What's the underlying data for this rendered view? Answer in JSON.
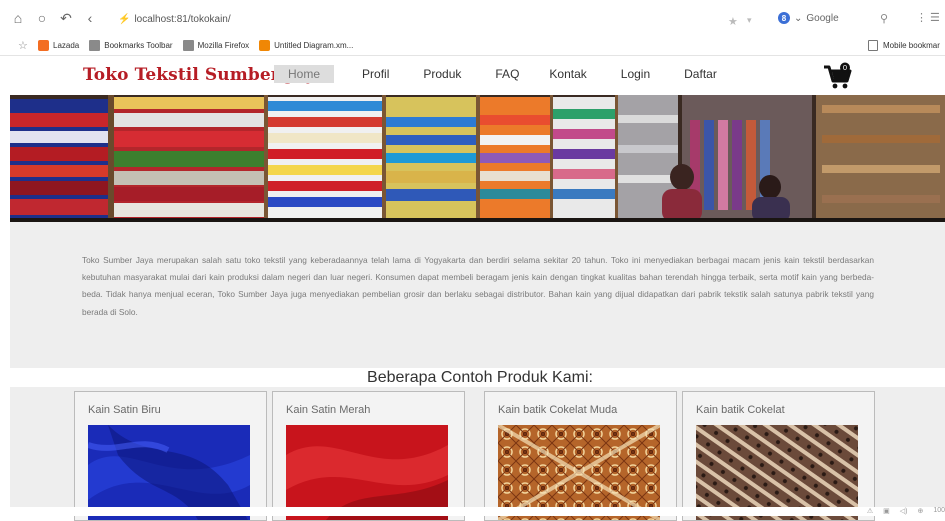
{
  "browser": {
    "url": "localhost:81/tokokain/",
    "search_engine": "Google",
    "bookmarks": [
      {
        "label": "Lazada",
        "icon": "lazada-icon"
      },
      {
        "label": "Bookmarks Toolbar",
        "icon": "folder-icon"
      },
      {
        "label": "Mozilla Firefox",
        "icon": "folder-icon"
      },
      {
        "label": "Untitled Diagram.xm...",
        "icon": "drawio-icon"
      }
    ],
    "mobile_bookmarks": "Mobile bookmar",
    "zoom": "100"
  },
  "site": {
    "brand": "Toko Tekstil Sumber Jaya",
    "menu": [
      {
        "label": "Home",
        "active": true
      },
      {
        "label": "Profil",
        "active": false
      },
      {
        "label": "Produk",
        "active": false
      },
      {
        "label": "FAQ",
        "active": false
      },
      {
        "label": "Kontak",
        "active": false
      },
      {
        "label": "Login",
        "active": false
      },
      {
        "label": "Daftar",
        "active": false
      }
    ],
    "cart_count": "0"
  },
  "about": {
    "text": "Toko Sumber Jaya merupakan salah satu toko tekstil yang keberadaannya telah lama di Yogyakarta dan berdiri selama sekitar 20 tahun. Toko ini menyediakan berbagai macam jenis kain tekstil berdasarkan kebutuhan masyarakat mulai dari kain produksi dalam negeri dan luar negeri. Konsumen dapat membeli beragam jenis kain dengan tingkat kualitas bahan terendah hingga terbaik, serta motif kain yang berbeda-beda. Tidak hanya menjual eceran, Toko Sumber Jaya juga menyediakan pembelian grosir dan berlaku sebagai distributor. Bahan kain yang dijual didapatkan dari pabrik tekstik salah satunya pabrik tekstil yang berada di Solo."
  },
  "products": {
    "title": "Beberapa Contoh Produk Kami:",
    "items": [
      {
        "name": "Kain Satin Biru",
        "color": "#1a2bb8"
      },
      {
        "name": "Kain Satin Merah",
        "color": "#c8141c"
      },
      {
        "name": "Kain batik Cokelat Muda",
        "color": "#b5652a"
      },
      {
        "name": "Kain batik Cokelat",
        "color": "#6b4a3a"
      }
    ]
  },
  "colors": {
    "brand": "#b61d25",
    "section_bg": "#eeeeee"
  }
}
